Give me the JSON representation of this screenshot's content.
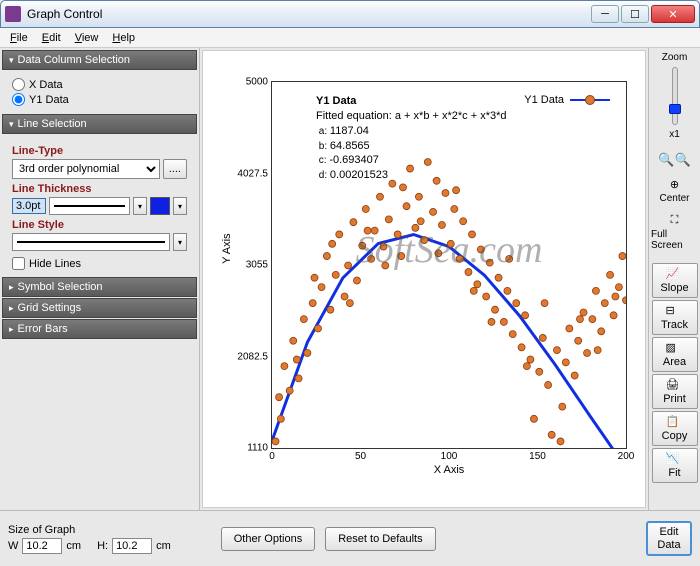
{
  "window": {
    "title": "Graph Control"
  },
  "menu": {
    "file": "File",
    "edit": "Edit",
    "view": "View",
    "help": "Help"
  },
  "sidebar": {
    "dataColumn": {
      "header": "Data Column Selection",
      "xdata": "X Data",
      "y1data": "Y1 Data"
    },
    "lineSel": {
      "header": "Line Selection",
      "lineType": "Line-Type",
      "lineTypeVal": "3rd order polynomial",
      "lineThick": "Line Thickness",
      "thickVal": "3.0pt",
      "lineStyle": "Line Style",
      "hide": "Hide Lines"
    },
    "symbolSel": {
      "header": "Symbol Selection"
    },
    "gridSet": {
      "header": "Grid Settings"
    },
    "errBars": {
      "header": "Error Bars"
    }
  },
  "chart_data": {
    "type": "scatter",
    "series_name": "Y1 Data",
    "fitted_equation": "Fitted equation: a + x*b + x*2*c + x*3*d",
    "params": {
      "a": "1187.04",
      "b": "64.8565",
      "c": "-0.693407",
      "d": "0.00201523"
    },
    "xlabel": "X Axis",
    "ylabel": "Y Axis",
    "xlim": [
      0,
      200
    ],
    "ylim": [
      1110,
      5000
    ],
    "xticks": [
      0,
      50,
      100,
      150,
      200
    ],
    "yticks": [
      1110,
      2082.5,
      3055,
      4027.5,
      5000
    ],
    "fit_curve": [
      [
        0,
        1187
      ],
      [
        20,
        2234
      ],
      [
        40,
        2917
      ],
      [
        60,
        3283
      ],
      [
        80,
        3379
      ],
      [
        100,
        3251
      ],
      [
        120,
        2947
      ],
      [
        140,
        2512
      ],
      [
        160,
        1995
      ],
      [
        180,
        1441
      ],
      [
        200,
        898
      ]
    ],
    "points": [
      [
        2,
        1180
      ],
      [
        5,
        1420
      ],
      [
        7,
        1980
      ],
      [
        10,
        1720
      ],
      [
        12,
        2250
      ],
      [
        15,
        1850
      ],
      [
        18,
        2480
      ],
      [
        20,
        2120
      ],
      [
        23,
        2650
      ],
      [
        26,
        2380
      ],
      [
        28,
        2820
      ],
      [
        31,
        3150
      ],
      [
        33,
        2580
      ],
      [
        36,
        2950
      ],
      [
        38,
        3380
      ],
      [
        41,
        2720
      ],
      [
        43,
        3050
      ],
      [
        46,
        3510
      ],
      [
        48,
        2890
      ],
      [
        51,
        3260
      ],
      [
        53,
        3650
      ],
      [
        56,
        3120
      ],
      [
        58,
        3420
      ],
      [
        61,
        3780
      ],
      [
        63,
        3250
      ],
      [
        66,
        3540
      ],
      [
        68,
        3920
      ],
      [
        71,
        3380
      ],
      [
        73,
        3150
      ],
      [
        76,
        3680
      ],
      [
        78,
        4080
      ],
      [
        81,
        3450
      ],
      [
        83,
        3780
      ],
      [
        86,
        3320
      ],
      [
        88,
        4150
      ],
      [
        91,
        3620
      ],
      [
        93,
        3950
      ],
      [
        96,
        3480
      ],
      [
        98,
        3820
      ],
      [
        101,
        3280
      ],
      [
        103,
        3650
      ],
      [
        106,
        3120
      ],
      [
        108,
        3520
      ],
      [
        111,
        2980
      ],
      [
        113,
        3380
      ],
      [
        116,
        2850
      ],
      [
        118,
        3220
      ],
      [
        121,
        2720
      ],
      [
        123,
        3080
      ],
      [
        126,
        2580
      ],
      [
        128,
        2920
      ],
      [
        131,
        2450
      ],
      [
        133,
        2780
      ],
      [
        136,
        2320
      ],
      [
        138,
        2650
      ],
      [
        141,
        2180
      ],
      [
        143,
        2520
      ],
      [
        146,
        2050
      ],
      [
        148,
        1420
      ],
      [
        151,
        1920
      ],
      [
        153,
        2280
      ],
      [
        156,
        1780
      ],
      [
        158,
        1250
      ],
      [
        161,
        2150
      ],
      [
        163,
        1180
      ],
      [
        166,
        2020
      ],
      [
        168,
        2380
      ],
      [
        171,
        1880
      ],
      [
        173,
        2250
      ],
      [
        176,
        2550
      ],
      [
        178,
        2120
      ],
      [
        181,
        2480
      ],
      [
        183,
        2780
      ],
      [
        186,
        2350
      ],
      [
        188,
        2650
      ],
      [
        191,
        2950
      ],
      [
        193,
        2520
      ],
      [
        196,
        2820
      ],
      [
        198,
        3150
      ],
      [
        200,
        2680
      ],
      [
        4,
        1650
      ],
      [
        14,
        2050
      ],
      [
        24,
        2920
      ],
      [
        34,
        3280
      ],
      [
        44,
        2650
      ],
      [
        54,
        3420
      ],
      [
        64,
        3050
      ],
      [
        74,
        3880
      ],
      [
        84,
        3520
      ],
      [
        94,
        3180
      ],
      [
        104,
        3850
      ],
      [
        114,
        2780
      ],
      [
        124,
        2450
      ],
      [
        134,
        3120
      ],
      [
        144,
        1980
      ],
      [
        154,
        2650
      ],
      [
        164,
        1550
      ],
      [
        174,
        2480
      ],
      [
        184,
        2150
      ],
      [
        194,
        2720
      ]
    ]
  },
  "rside": {
    "zoom": "Zoom",
    "zoomVal": "x1",
    "center": "Center",
    "fullscreen": "Full Screen",
    "slope": "Slope",
    "track": "Track",
    "area": "Area",
    "print": "Print",
    "copy": "Copy",
    "fit": "Fit"
  },
  "bottom": {
    "sizeLabel": "Size of Graph",
    "w": "W",
    "h": "H:",
    "wval": "10.2",
    "hval": "10.2",
    "unit": "cm",
    "other": "Other Options",
    "reset": "Reset to Defaults",
    "editData": "Edit Data"
  }
}
